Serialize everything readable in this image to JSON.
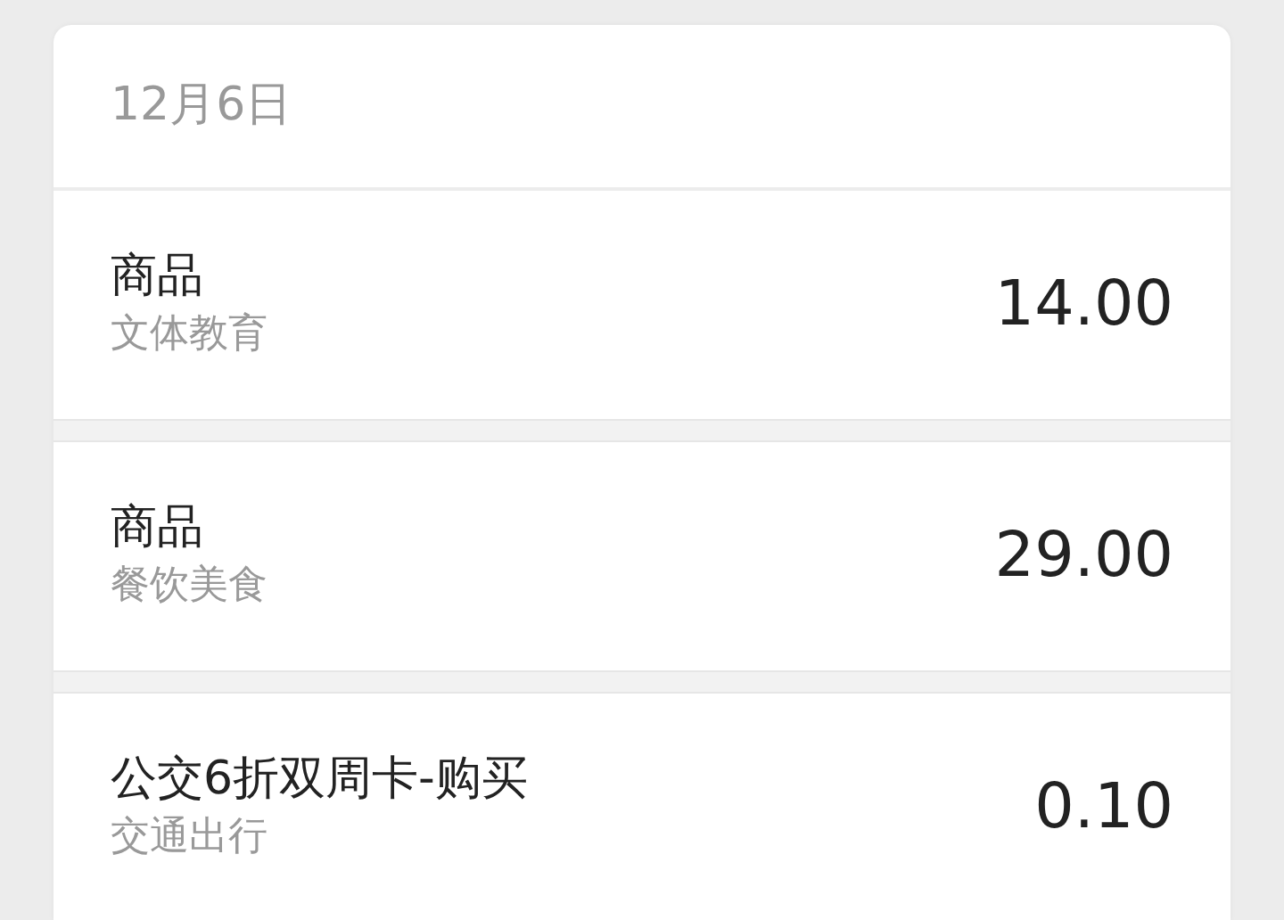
{
  "date_header": "12月6日",
  "transactions": [
    {
      "title": "商品",
      "category": "文体教育",
      "amount": "14.00"
    },
    {
      "title": "商品",
      "category": "餐饮美食",
      "amount": "29.00"
    },
    {
      "title": "公交6折双周卡-购买",
      "category": "交通出行",
      "amount": "0.10"
    }
  ]
}
